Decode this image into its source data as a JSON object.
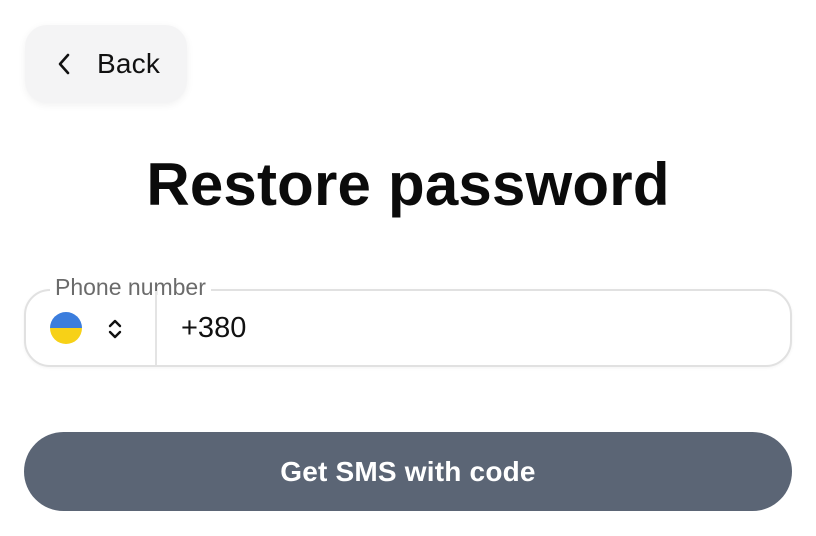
{
  "back": {
    "label": "Back",
    "icon": "chevron-left-icon"
  },
  "title": "Restore password",
  "phone": {
    "label": "Phone number",
    "value": "+380",
    "country": {
      "flag": "ukraine-flag-icon",
      "flag_colors": [
        "#3b7ddd",
        "#f7d117"
      ],
      "selector_icon": "chevron-up-down-icon"
    }
  },
  "submit": {
    "label": "Get SMS with code",
    "color": "#5b6575"
  }
}
